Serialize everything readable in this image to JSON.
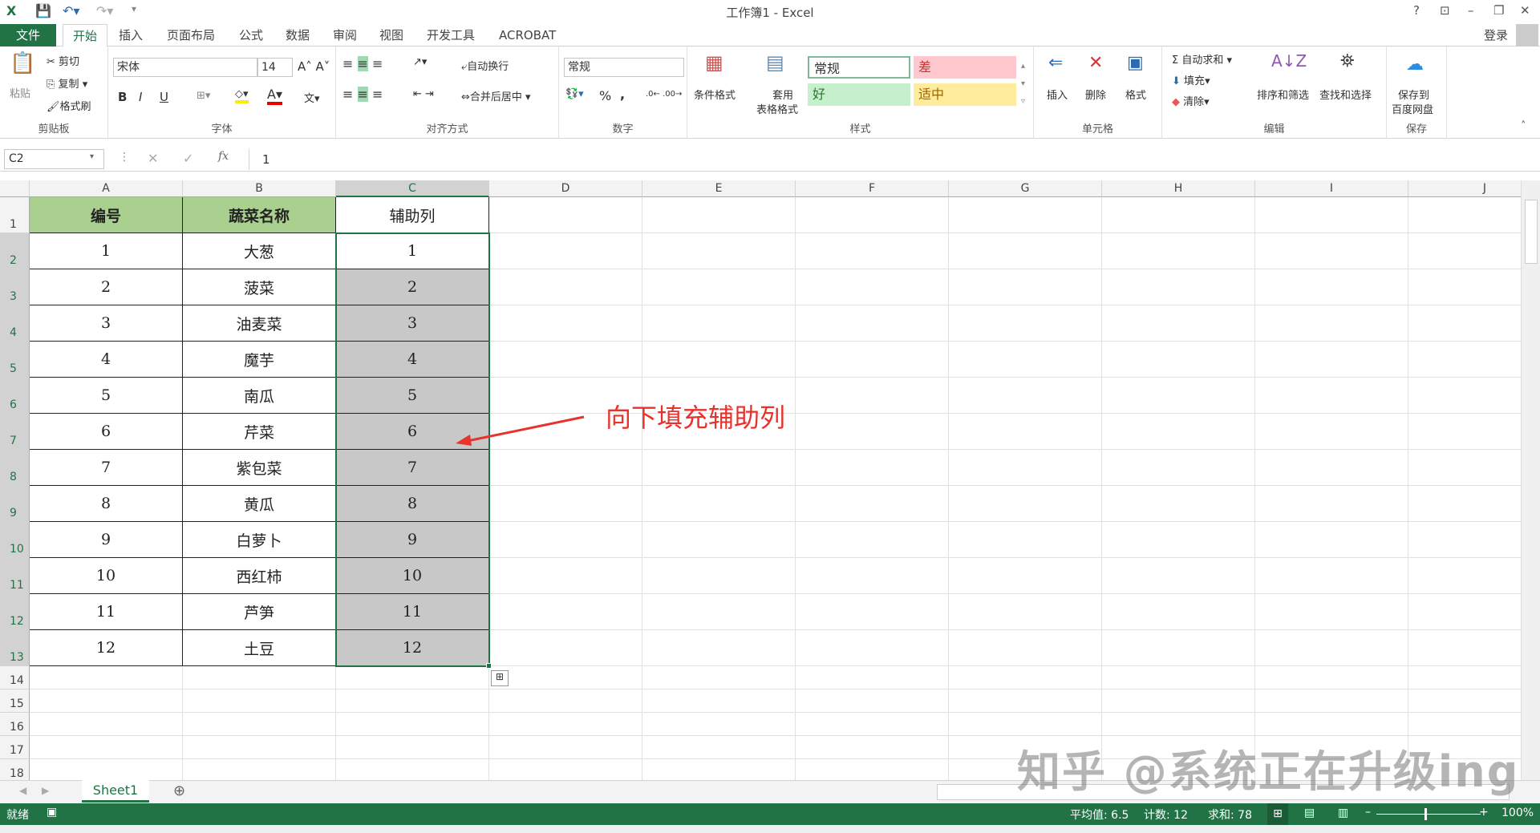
{
  "title": "工作簿1 - Excel",
  "window": {
    "help": "?",
    "restore_ribbon": "⊡",
    "minimize": "–",
    "maximize": "❐",
    "close": "✕"
  },
  "tabs": [
    "文件",
    "开始",
    "插入",
    "页面布局",
    "公式",
    "数据",
    "审阅",
    "视图",
    "开发工具",
    "ACROBAT"
  ],
  "login": "登录",
  "ribbon": {
    "clipboard": {
      "label": "剪贴板",
      "paste": "粘贴",
      "cut": "剪切",
      "copy": "复制",
      "format_painter": "格式刷"
    },
    "font": {
      "label": "字体",
      "font_name": "宋体",
      "font_size": "14",
      "bold": "B",
      "italic": "I",
      "underline": "U"
    },
    "alignment": {
      "label": "对齐方式",
      "wrap": "自动换行",
      "merge": "合并后居中"
    },
    "number": {
      "label": "数字",
      "format": "常规",
      "percent": "%",
      "comma": ","
    },
    "styles": {
      "label": "样式",
      "conditional": "条件格式",
      "table_format_1": "套用",
      "table_format_2": "表格格式",
      "normal": "常规",
      "bad": "差",
      "good": "好",
      "neutral": "适中"
    },
    "cells": {
      "label": "单元格",
      "insert": "插入",
      "delete": "删除",
      "format": "格式"
    },
    "editing": {
      "label": "编辑",
      "autosum": "自动求和",
      "fill": "填充",
      "clear": "清除",
      "sort_filter": "排序和筛选",
      "find_select": "查找和选择"
    },
    "save": {
      "label": "保存",
      "save_to_1": "保存到",
      "save_to_2": "百度网盘"
    }
  },
  "formula_bar": {
    "name_box": "C2",
    "fx": "fx",
    "value": "1"
  },
  "columns": [
    "A",
    "B",
    "C",
    "D",
    "E",
    "F",
    "G",
    "H",
    "I",
    "J"
  ],
  "rows": [
    "1",
    "2",
    "3",
    "4",
    "5",
    "6",
    "7",
    "8",
    "9",
    "10",
    "11",
    "12",
    "13",
    "14",
    "15",
    "16",
    "17",
    "18"
  ],
  "table": {
    "headers": [
      "编号",
      "蔬菜名称",
      "辅助列"
    ],
    "data": [
      [
        "1",
        "大葱",
        "1"
      ],
      [
        "2",
        "菠菜",
        "2"
      ],
      [
        "3",
        "油麦菜",
        "3"
      ],
      [
        "4",
        "魔芋",
        "4"
      ],
      [
        "5",
        "南瓜",
        "5"
      ],
      [
        "6",
        "芹菜",
        "6"
      ],
      [
        "7",
        "紫包菜",
        "7"
      ],
      [
        "8",
        "黄瓜",
        "8"
      ],
      [
        "9",
        "白萝卜",
        "9"
      ],
      [
        "10",
        "西红柿",
        "10"
      ],
      [
        "11",
        "芦笋",
        "11"
      ],
      [
        "12",
        "土豆",
        "12"
      ]
    ]
  },
  "annotation": "向下填充辅助列",
  "sheet_tab": "Sheet1",
  "status": {
    "ready": "就绪",
    "average": "平均值: 6.5",
    "count": "计数: 12",
    "sum": "求和: 78",
    "zoom": "100%"
  },
  "watermark": "知乎 @系统正在升级ing",
  "colors": {
    "accent": "#217346",
    "header_fill": "#a9d08e",
    "annotation": "#e8322c"
  }
}
